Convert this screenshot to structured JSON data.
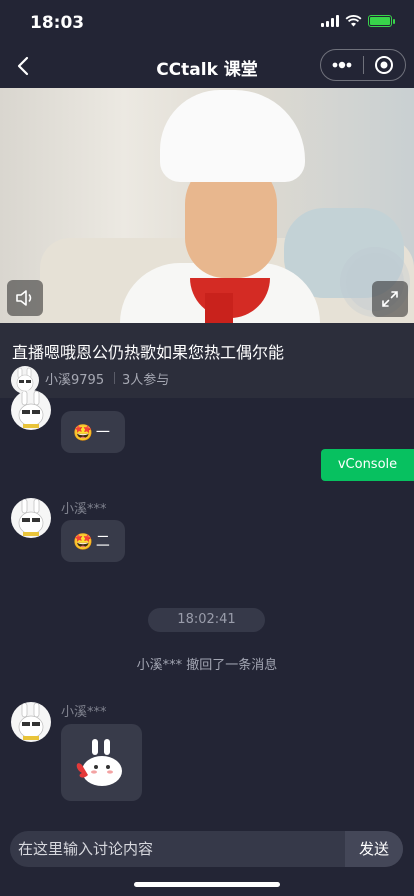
{
  "status": {
    "time": "18:03"
  },
  "nav": {
    "title": "CCtalk 课堂",
    "back_icon": "chevron-left-icon",
    "more_icon": "more-icon",
    "close_icon": "target-icon"
  },
  "video": {
    "volume_icon": "volume-icon",
    "fullscreen_icon": "fullscreen-icon"
  },
  "course": {
    "title": "直播嗯哦恩公仍热歌如果您热工偶尔能",
    "teacher": "小溪9795",
    "participants": "3人参与"
  },
  "messages": [
    {
      "text": "一",
      "emoji": "🤩"
    },
    {
      "sender": "小溪***",
      "text": "二",
      "emoji": "🤩"
    },
    {
      "sender": "小溪***",
      "sticker": "rabbit-sticker"
    }
  ],
  "timestamp": "18:02:41",
  "recall_notice": "小溪*** 撤回了一条消息",
  "vconsole_label": "vConsole",
  "input": {
    "placeholder": "在这里输入讨论内容",
    "send_label": "发送"
  },
  "colors": {
    "background": "#232535",
    "accent": "#07c160",
    "bubble": "#383b4a"
  }
}
